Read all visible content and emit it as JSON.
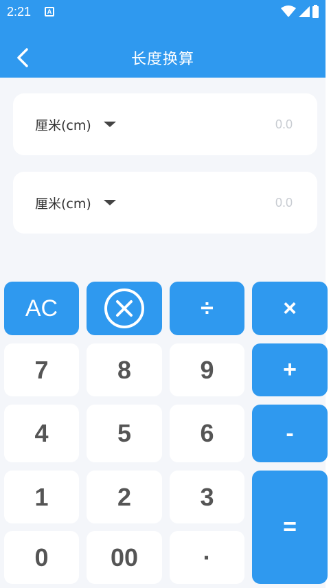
{
  "status_bar": {
    "time": "2:21",
    "notification_icon": "A"
  },
  "app_bar": {
    "title": "长度换算",
    "back_icon": "chevron-left-icon"
  },
  "converter": {
    "from": {
      "unit": "厘米(cm)",
      "value": "0.0"
    },
    "to": {
      "unit": "厘米(cm)",
      "value": "0.0"
    }
  },
  "keypad": {
    "ac": "AC",
    "delete_icon": "backspace-circle-x-icon",
    "divide": "÷",
    "multiply": "×",
    "plus": "+",
    "minus": "-",
    "equals": "=",
    "k7": "7",
    "k8": "8",
    "k9": "9",
    "k4": "4",
    "k5": "5",
    "k6": "6",
    "k1": "1",
    "k2": "2",
    "k3": "3",
    "k0": "0",
    "k00": "00",
    "dot": "·"
  },
  "colors": {
    "primary": "#2f99ef",
    "background": "#f4f6fa",
    "card": "#ffffff",
    "key_text": "#555555",
    "placeholder_value": "#c8ccd2"
  }
}
